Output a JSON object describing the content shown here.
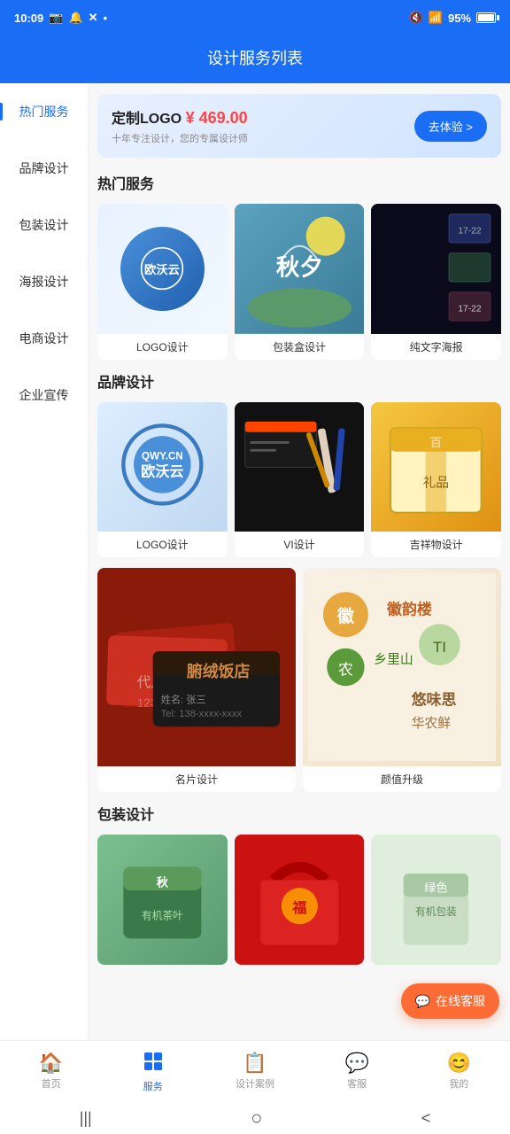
{
  "statusBar": {
    "time": "10:09",
    "battery": "95%"
  },
  "header": {
    "title": "设计服务列表"
  },
  "banner": {
    "titlePart1": "定制LOGO",
    "price": "¥ 469.00",
    "subtitle": "十年专注设计，您的专属设计师",
    "btnText": "去体验 >"
  },
  "sidebar": {
    "items": [
      {
        "label": "热门服务",
        "active": true
      },
      {
        "label": "品牌设计",
        "active": false
      },
      {
        "label": "包装设计",
        "active": false
      },
      {
        "label": "海报设计",
        "active": false
      },
      {
        "label": "电商设计",
        "active": false
      },
      {
        "label": "企业宣传",
        "active": false
      }
    ]
  },
  "sections": {
    "hotServices": {
      "title": "热门服务",
      "items": [
        {
          "label": "LOGO设计"
        },
        {
          "label": "包装盒设计"
        },
        {
          "label": "纯文字海报"
        }
      ]
    },
    "brandDesign": {
      "title": "品牌设计",
      "row1": [
        {
          "label": "LOGO设计"
        },
        {
          "label": "VI设计"
        },
        {
          "label": "吉祥物设计"
        }
      ],
      "row2": [
        {
          "label": "名片设计"
        },
        {
          "label": "颜值升级"
        }
      ]
    },
    "packagingDesign": {
      "title": "包装设计"
    }
  },
  "customerService": {
    "label": "在线客服"
  },
  "bottomNav": {
    "items": [
      {
        "icon": "🏠",
        "label": "首页",
        "active": false
      },
      {
        "icon": "⊞",
        "label": "服务",
        "active": true
      },
      {
        "icon": "📋",
        "label": "设计案例",
        "active": false
      },
      {
        "icon": "💬",
        "label": "客服",
        "active": false
      },
      {
        "icon": "😊",
        "label": "我的",
        "active": false
      }
    ]
  },
  "systemBar": {
    "backBtn": "|||",
    "homeBtn": "○",
    "recentsBtn": "<"
  }
}
